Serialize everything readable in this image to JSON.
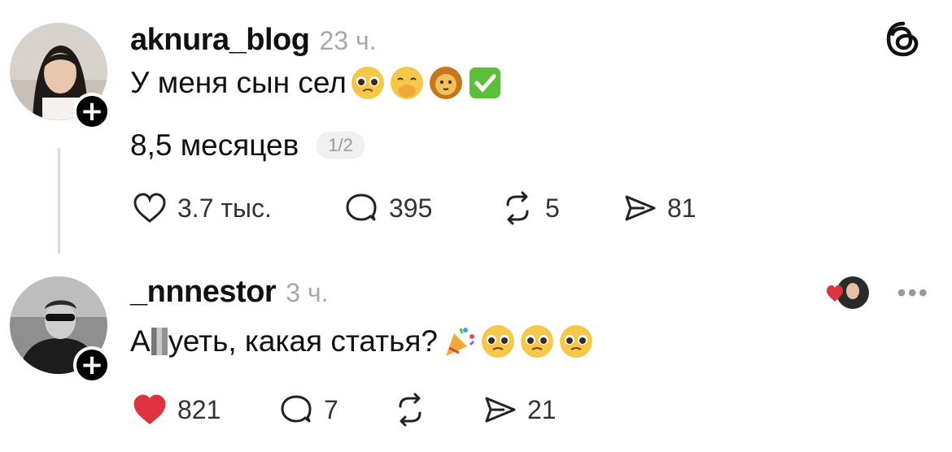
{
  "colors": {
    "text": "#111111",
    "muted": "#a8a8a8",
    "like_red": "#e0323f",
    "thread_line": "#d9d9d9"
  },
  "app_logo": "threads-icon",
  "posts": [
    {
      "username": "aknura_blog",
      "time": "23 ч.",
      "line1_text": "У меня сын сел",
      "line1_emojis": [
        "pleading-face-icon",
        "hand-over-mouth-icon",
        "lion-icon",
        "check-mark-button-icon"
      ],
      "line2_text": "8,5 месяцев",
      "pager": "1/2",
      "likes": "3.7 тыс.",
      "liked": false,
      "replies": "395",
      "reposts": "5",
      "shares": "81"
    },
    {
      "username": "_nnnestor",
      "time": "3 ч.",
      "line1_prefix": "А",
      "line1_suffix": "уеть, какая статья?",
      "line1_emojis": [
        "party-popper-icon",
        "pleading-face-icon",
        "pleading-face-icon",
        "pleading-face-icon"
      ],
      "likes": "821",
      "liked": true,
      "replies": "7",
      "reposts": "",
      "shares": "21",
      "more_menu": "•••"
    }
  ]
}
